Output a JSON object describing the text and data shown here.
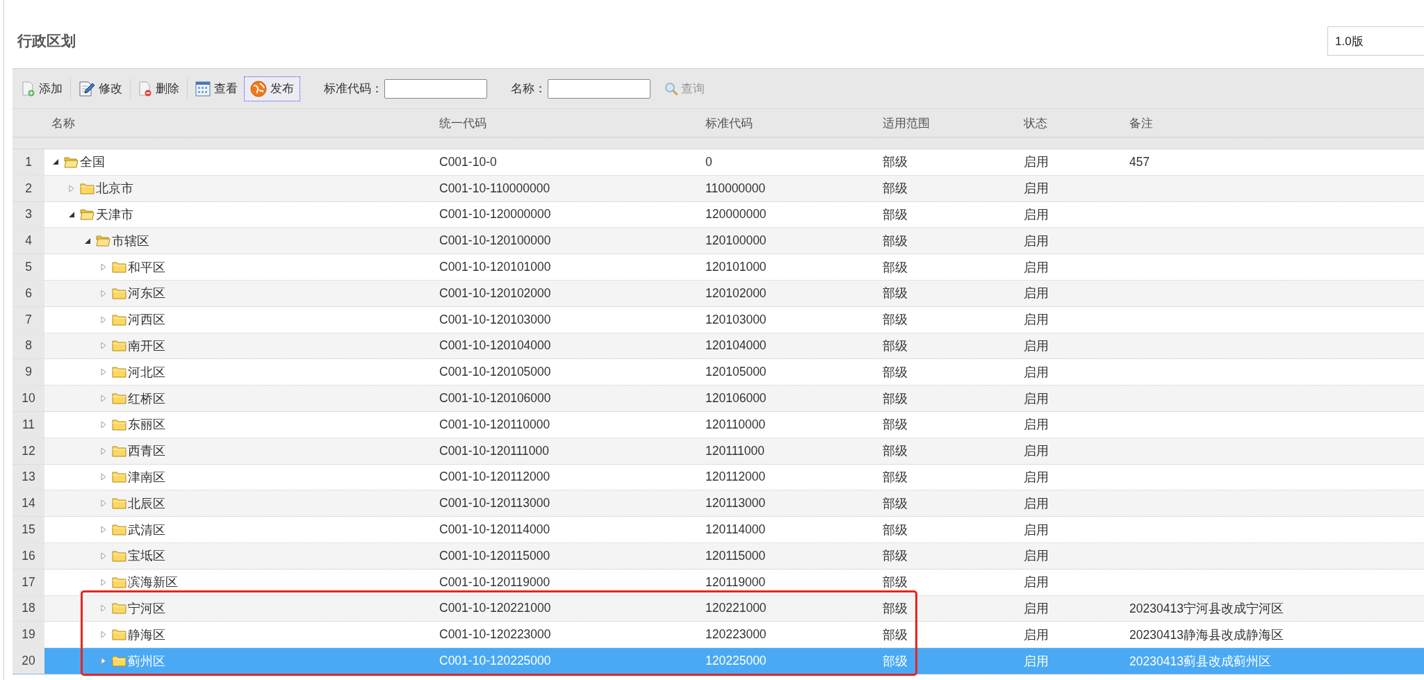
{
  "page": {
    "title": "行政区划",
    "version": "1.0版"
  },
  "toolbar": {
    "buttons": [
      {
        "label": "添加",
        "kind": "add",
        "focused": false
      },
      {
        "label": "修改",
        "kind": "edit",
        "focused": false
      },
      {
        "label": "删除",
        "kind": "delete",
        "focused": false
      },
      {
        "label": "查看",
        "kind": "view",
        "focused": false
      },
      {
        "label": "发布",
        "kind": "publish",
        "focused": true
      }
    ],
    "filters": [
      {
        "label": "标准代码："
      },
      {
        "label": "名称："
      }
    ],
    "query_button": {
      "label": "查询",
      "disabled": true
    }
  },
  "grid": {
    "columns": [
      "名称",
      "统一代码",
      "标准代码",
      "适用范围",
      "状态",
      "备注"
    ],
    "rows": [
      {
        "number": "1",
        "name": "全国",
        "code": "C001-10-0",
        "standard_code": "0",
        "scope": "部级",
        "status": "启用",
        "note": "457",
        "expanded": true,
        "selected": false,
        "children": [
          {
            "number": "2",
            "name": "北京市",
            "code": "C001-10-110000000",
            "standard_code": "110000000",
            "scope": "部级",
            "status": "启用",
            "expanded": false,
            "selected": false
          },
          {
            "number": "3",
            "name": "天津市",
            "code": "C001-10-120000000",
            "standard_code": "120000000",
            "scope": "部级",
            "status": "启用",
            "expanded": true,
            "selected": false,
            "children": [
              {
                "number": "4",
                "name": "市辖区",
                "code": "C001-10-120100000",
                "standard_code": "120100000",
                "scope": "部级",
                "status": "启用",
                "expanded": true,
                "selected": false,
                "children": [
                  {
                    "number": "5",
                    "name": "和平区",
                    "code": "C001-10-120101000",
                    "standard_code": "120101000",
                    "scope": "部级",
                    "status": "启用",
                    "expanded": false,
                    "selected": false
                  },
                  {
                    "number": "6",
                    "name": "河东区",
                    "code": "C001-10-120102000",
                    "standard_code": "120102000",
                    "scope": "部级",
                    "status": "启用",
                    "expanded": false,
                    "selected": false
                  },
                  {
                    "number": "7",
                    "name": "河西区",
                    "code": "C001-10-120103000",
                    "standard_code": "120103000",
                    "scope": "部级",
                    "status": "启用",
                    "expanded": false,
                    "selected": false
                  },
                  {
                    "number": "8",
                    "name": "南开区",
                    "code": "C001-10-120104000",
                    "standard_code": "120104000",
                    "scope": "部级",
                    "status": "启用",
                    "expanded": false,
                    "selected": false
                  },
                  {
                    "number": "9",
                    "name": "河北区",
                    "code": "C001-10-120105000",
                    "standard_code": "120105000",
                    "scope": "部级",
                    "status": "启用",
                    "expanded": false,
                    "selected": false
                  },
                  {
                    "number": "10",
                    "name": "红桥区",
                    "code": "C001-10-120106000",
                    "standard_code": "120106000",
                    "scope": "部级",
                    "status": "启用",
                    "expanded": false,
                    "selected": false
                  },
                  {
                    "number": "11",
                    "name": "东丽区",
                    "code": "C001-10-120110000",
                    "standard_code": "120110000",
                    "scope": "部级",
                    "status": "启用",
                    "expanded": false,
                    "selected": false
                  },
                  {
                    "number": "12",
                    "name": "西青区",
                    "code": "C001-10-120111000",
                    "standard_code": "120111000",
                    "scope": "部级",
                    "status": "启用",
                    "expanded": false,
                    "selected": false
                  },
                  {
                    "number": "13",
                    "name": "津南区",
                    "code": "C001-10-120112000",
                    "standard_code": "120112000",
                    "scope": "部级",
                    "status": "启用",
                    "expanded": false,
                    "selected": false
                  },
                  {
                    "number": "14",
                    "name": "北辰区",
                    "code": "C001-10-120113000",
                    "standard_code": "120113000",
                    "scope": "部级",
                    "status": "启用",
                    "expanded": false,
                    "selected": false
                  },
                  {
                    "number": "15",
                    "name": "武清区",
                    "code": "C001-10-120114000",
                    "standard_code": "120114000",
                    "scope": "部级",
                    "status": "启用",
                    "expanded": false,
                    "selected": false
                  },
                  {
                    "number": "16",
                    "name": "宝坻区",
                    "code": "C001-10-120115000",
                    "standard_code": "120115000",
                    "scope": "部级",
                    "status": "启用",
                    "expanded": false,
                    "selected": false
                  },
                  {
                    "number": "17",
                    "name": "滨海新区",
                    "code": "C001-10-120119000",
                    "standard_code": "120119000",
                    "scope": "部级",
                    "status": "启用",
                    "expanded": false,
                    "selected": false
                  },
                  {
                    "number": "18",
                    "name": "宁河区",
                    "code": "C001-10-120221000",
                    "standard_code": "120221000",
                    "scope": "部级",
                    "status": "启用",
                    "note": "20230413宁河县改成宁河区",
                    "expanded": false,
                    "selected": false,
                    "highlighted": true
                  },
                  {
                    "number": "19",
                    "name": "静海区",
                    "code": "C001-10-120223000",
                    "standard_code": "120223000",
                    "scope": "部级",
                    "status": "启用",
                    "note": "20230413静海县改成静海区",
                    "expanded": false,
                    "selected": false,
                    "highlighted": true
                  },
                  {
                    "number": "20",
                    "name": "蓟州区",
                    "code": "C001-10-120225000",
                    "standard_code": "120225000",
                    "scope": "部级",
                    "status": "启用",
                    "note": "20230413蓟县改成蓟州区",
                    "expanded": false,
                    "selected": true,
                    "highlighted": true
                  }
                ]
              }
            ]
          }
        ]
      }
    ]
  }
}
